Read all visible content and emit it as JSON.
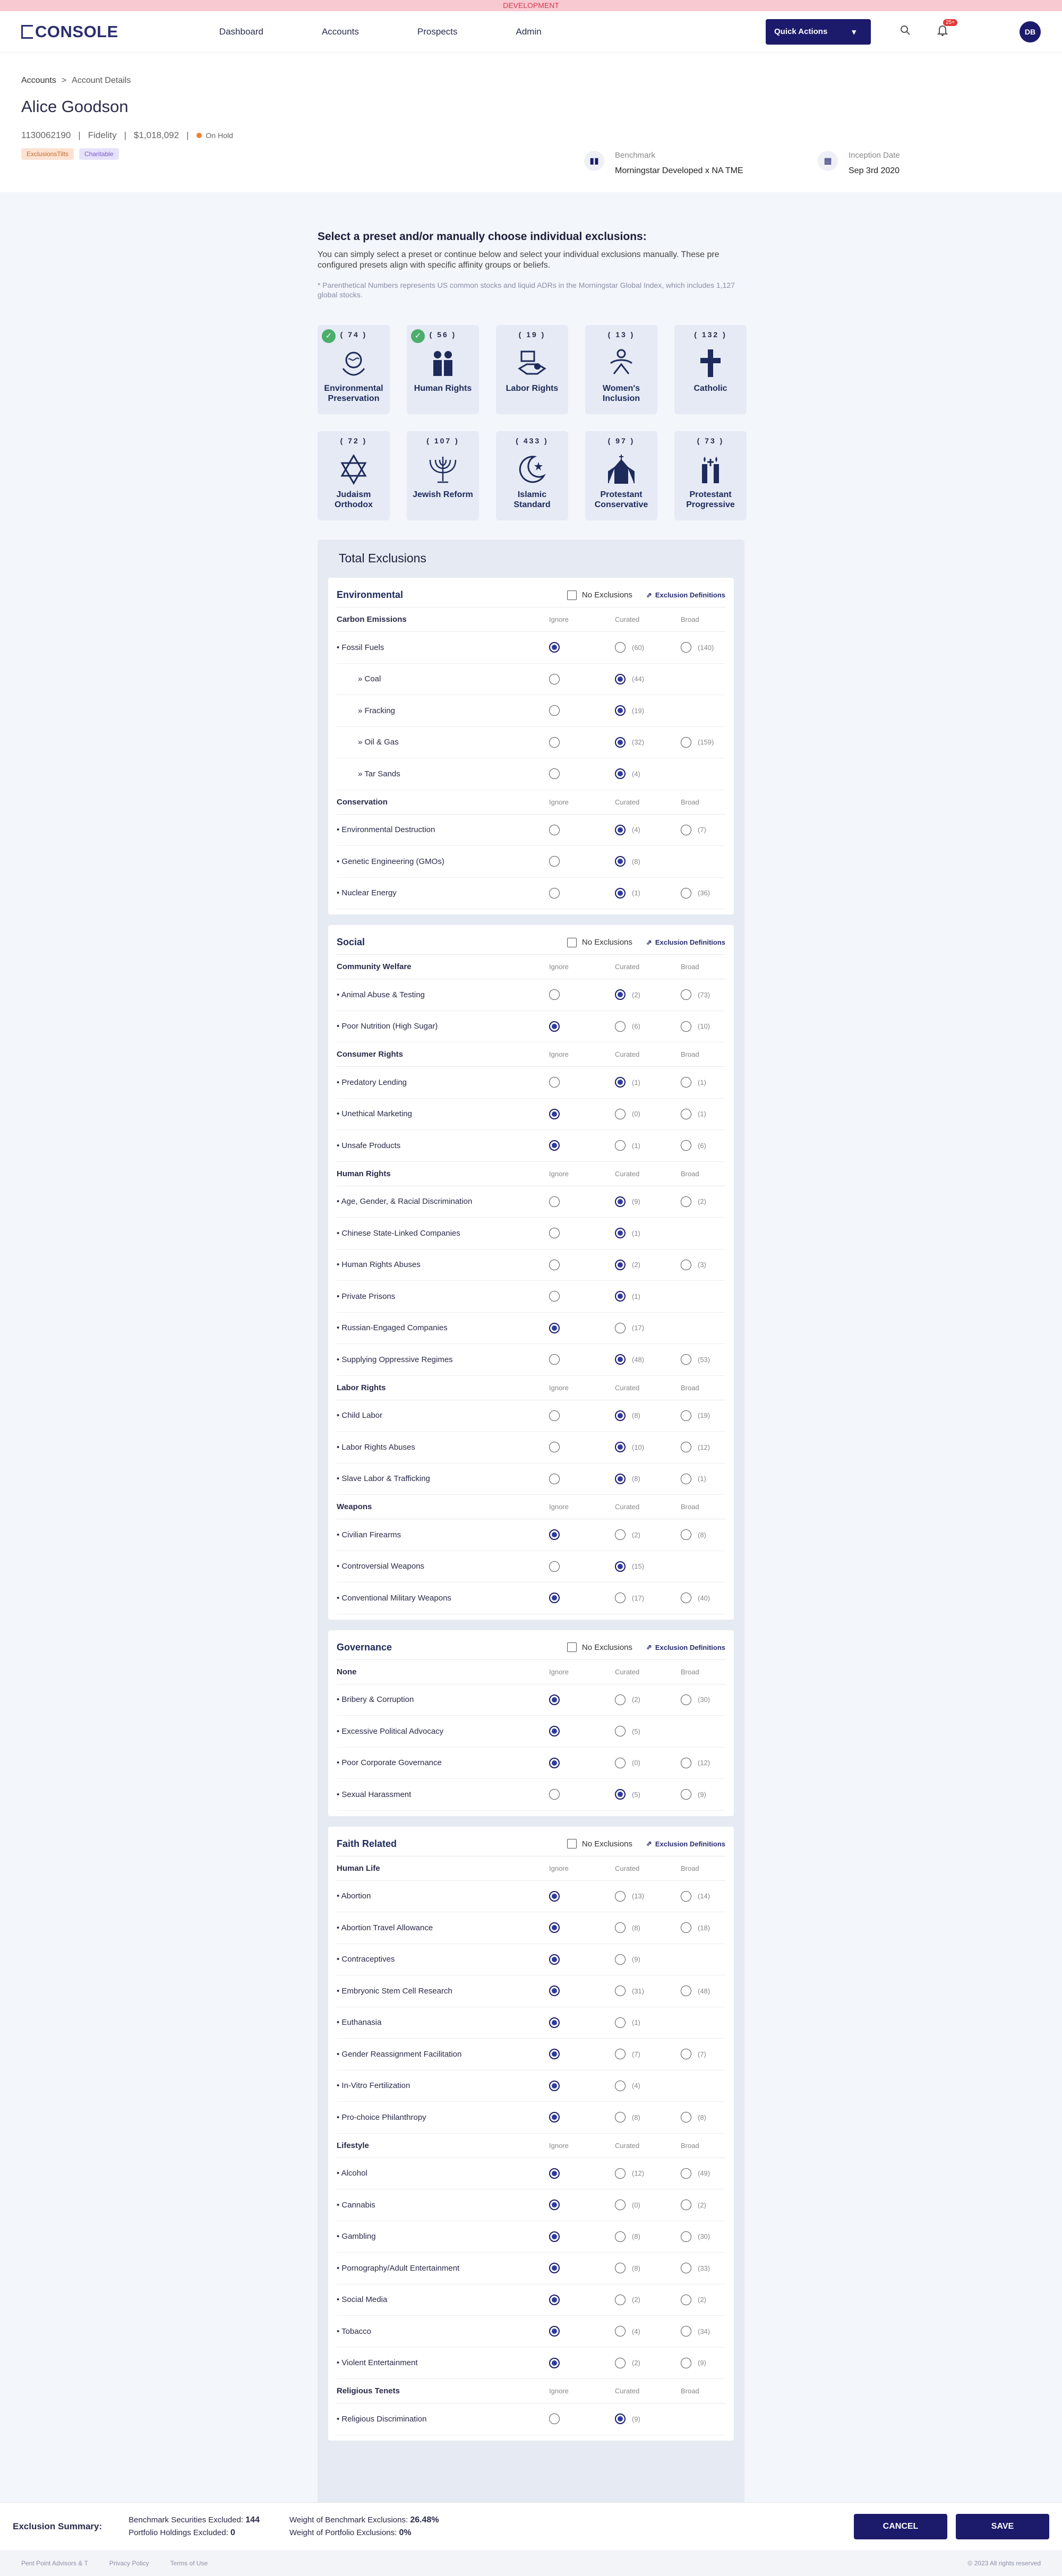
{
  "dev_banner": "DEVELOPMENT",
  "brand": "CONSOLE",
  "nav": [
    "Dashboard",
    "Accounts",
    "Prospects",
    "Admin"
  ],
  "quick_actions": "Quick Actions",
  "notif_count": "25+",
  "user_initials": "DB",
  "breadcrumb": {
    "root": "Accounts",
    "sep": ">",
    "current": "Account Details"
  },
  "client": {
    "name": "Alice Goodson",
    "account": "1130062190",
    "custodian": "Fidelity",
    "value": "$1,018,092",
    "status": "On Hold",
    "tags": [
      "ExclusionsTilts",
      "Charitable"
    ]
  },
  "benchmark": {
    "label": "Benchmark",
    "value": "Morningstar Developed x NA TME"
  },
  "inception": {
    "label": "Inception Date",
    "value": "Sep 3rd 2020"
  },
  "intro": {
    "title": "Select a preset and/or manually choose individual exclusions:",
    "text": "You can simply select a preset or continue below and select your individual exclusions manually. These pre configured presets align with specific affinity groups or beliefs.",
    "footnote": "* Parenthetical Numbers represents US common stocks and liquid ADRs in the Morningstar Global Index, which includes 1,127 global stocks."
  },
  "presets": [
    {
      "name": "Environmental Preservation",
      "count": "( 74 )",
      "checked": true,
      "icon": "globe-hands-icon"
    },
    {
      "name": "Human Rights",
      "count": "( 56 )",
      "checked": true,
      "icon": "people-icon"
    },
    {
      "name": "Labor Rights",
      "count": "( 19 )",
      "checked": false,
      "icon": "handshake-icon"
    },
    {
      "name": "Women's Inclusion",
      "count": "( 13 )",
      "checked": false,
      "icon": "women-icon"
    },
    {
      "name": "Catholic",
      "count": "( 132 )",
      "checked": false,
      "icon": "cross-icon"
    },
    {
      "name": "Judaism Orthodox",
      "count": "( 72 )",
      "checked": false,
      "icon": "star-of-david-icon"
    },
    {
      "name": "Jewish Reform",
      "count": "( 107 )",
      "checked": false,
      "icon": "menorah-icon"
    },
    {
      "name": "Islamic Standard",
      "count": "( 433 )",
      "checked": false,
      "icon": "crescent-icon"
    },
    {
      "name": "Protestant Conservative",
      "count": "( 97 )",
      "checked": false,
      "icon": "church-icon"
    },
    {
      "name": "Protestant Progressive",
      "count": "( 73 )",
      "checked": false,
      "icon": "candles-icon"
    }
  ],
  "total_title": "Total Exclusions",
  "no_exclusions_label": "No Exclusions",
  "exclusion_definitions_label": "Exclusion Definitions",
  "col_labels": {
    "ignore": "Ignore",
    "curated": "Curated",
    "broad": "Broad"
  },
  "categories": [
    {
      "title": "Environmental",
      "groups": [
        {
          "name": "Carbon Emissions",
          "rows": [
            {
              "n": "• Fossil Fuels",
              "sel": 0,
              "c": "(60)",
              "b": "(140)"
            },
            {
              "n": "» Coal",
              "sub": true,
              "sel": 1,
              "c": "(44)",
              "b": null
            },
            {
              "n": "» Fracking",
              "sub": true,
              "sel": 1,
              "c": "(19)",
              "b": null
            },
            {
              "n": "» Oil & Gas",
              "sub": true,
              "sel": 1,
              "c": "(32)",
              "b": "(159)"
            },
            {
              "n": "» Tar Sands",
              "sub": true,
              "sel": 1,
              "c": "(4)",
              "b": null
            }
          ]
        },
        {
          "name": "Conservation",
          "rows": [
            {
              "n": "• Environmental Destruction",
              "sel": 1,
              "c": "(4)",
              "b": "(7)"
            },
            {
              "n": "• Genetic Engineering (GMOs)",
              "sel": 1,
              "c": "(8)",
              "b": null
            },
            {
              "n": "• Nuclear Energy",
              "sel": 1,
              "c": "(1)",
              "b": "(36)"
            }
          ]
        }
      ]
    },
    {
      "title": "Social",
      "groups": [
        {
          "name": "Community Welfare",
          "rows": [
            {
              "n": "• Animal Abuse & Testing",
              "sel": 1,
              "c": "(2)",
              "b": "(73)"
            },
            {
              "n": "• Poor Nutrition (High Sugar)",
              "sel": 0,
              "c": "(6)",
              "b": "(10)"
            }
          ]
        },
        {
          "name": "Consumer Rights",
          "rows": [
            {
              "n": "• Predatory Lending",
              "sel": 1,
              "c": "(1)",
              "b": "(1)"
            },
            {
              "n": "• Unethical Marketing",
              "sel": 0,
              "c": "(0)",
              "b": "(1)"
            },
            {
              "n": "• Unsafe Products",
              "sel": 0,
              "c": "(1)",
              "b": "(6)"
            }
          ]
        },
        {
          "name": "Human Rights",
          "rows": [
            {
              "n": "• Age, Gender, & Racial Discrimination",
              "sel": 1,
              "c": "(9)",
              "b": "(2)"
            },
            {
              "n": "• Chinese State-Linked Companies",
              "sel": 1,
              "c": "(1)",
              "b": null
            },
            {
              "n": "• Human Rights Abuses",
              "sel": 1,
              "c": "(2)",
              "b": "(3)"
            },
            {
              "n": "• Private Prisons",
              "sel": 1,
              "c": "(1)",
              "b": null
            },
            {
              "n": "• Russian-Engaged Companies",
              "sel": 0,
              "c": "(17)",
              "b": null
            },
            {
              "n": "• Supplying Oppressive Regimes",
              "sel": 1,
              "c": "(48)",
              "b": "(53)"
            }
          ]
        },
        {
          "name": "Labor Rights",
          "rows": [
            {
              "n": "• Child Labor",
              "sel": 1,
              "c": "(8)",
              "b": "(19)"
            },
            {
              "n": "• Labor Rights Abuses",
              "sel": 1,
              "c": "(10)",
              "b": "(12)"
            },
            {
              "n": "• Slave Labor & Trafficking",
              "sel": 1,
              "c": "(8)",
              "b": "(1)"
            }
          ]
        },
        {
          "name": "Weapons",
          "rows": [
            {
              "n": "• Civilian Firearms",
              "sel": 0,
              "c": "(2)",
              "b": "(8)"
            },
            {
              "n": "• Controversial Weapons",
              "sel": 1,
              "c": "(15)",
              "b": null
            },
            {
              "n": "• Conventional Military Weapons",
              "sel": 0,
              "c": "(17)",
              "b": "(40)"
            }
          ]
        }
      ]
    },
    {
      "title": "Governance",
      "groups": [
        {
          "name": "None",
          "rows": [
            {
              "n": "• Bribery & Corruption",
              "sel": 0,
              "c": "(2)",
              "b": "(30)"
            },
            {
              "n": "• Excessive Political Advocacy",
              "sel": 0,
              "c": "(5)",
              "b": null
            },
            {
              "n": "• Poor Corporate Governance",
              "sel": 0,
              "c": "(0)",
              "b": "(12)"
            },
            {
              "n": "• Sexual Harassment",
              "sel": 1,
              "c": "(5)",
              "b": "(9)"
            }
          ]
        }
      ]
    },
    {
      "title": "Faith Related",
      "groups": [
        {
          "name": "Human Life",
          "rows": [
            {
              "n": "• Abortion",
              "sel": 0,
              "c": "(13)",
              "b": "(14)"
            },
            {
              "n": "• Abortion Travel Allowance",
              "sel": 0,
              "c": "(8)",
              "b": "(18)"
            },
            {
              "n": "• Contraceptives",
              "sel": 0,
              "c": "(9)",
              "b": null
            },
            {
              "n": "• Embryonic Stem Cell Research",
              "sel": 0,
              "c": "(31)",
              "b": "(48)"
            },
            {
              "n": "• Euthanasia",
              "sel": 0,
              "c": "(1)",
              "b": null
            },
            {
              "n": "• Gender Reassignment Facilitation",
              "sel": 0,
              "c": "(7)",
              "b": "(7)"
            },
            {
              "n": "• In-Vitro Fertilization",
              "sel": 0,
              "c": "(4)",
              "b": null
            },
            {
              "n": "• Pro-choice Philanthropy",
              "sel": 0,
              "c": "(8)",
              "b": "(8)"
            }
          ]
        },
        {
          "name": "Lifestyle",
          "rows": [
            {
              "n": "• Alcohol",
              "sel": 0,
              "c": "(12)",
              "b": "(49)"
            },
            {
              "n": "• Cannabis",
              "sel": 0,
              "c": "(0)",
              "b": "(2)"
            },
            {
              "n": "• Gambling",
              "sel": 0,
              "c": "(8)",
              "b": "(30)"
            },
            {
              "n": "• Pornography/Adult Entertainment",
              "sel": 0,
              "c": "(8)",
              "b": "(33)"
            },
            {
              "n": "• Social Media",
              "sel": 0,
              "c": "(2)",
              "b": "(2)"
            },
            {
              "n": "• Tobacco",
              "sel": 0,
              "c": "(4)",
              "b": "(34)"
            },
            {
              "n": "• Violent Entertainment",
              "sel": 0,
              "c": "(2)",
              "b": "(9)"
            }
          ]
        },
        {
          "name": "Religious Tenets",
          "rows": [
            {
              "n": "• Religious Discrimination",
              "sel": 1,
              "c": "(9)",
              "b": null
            }
          ]
        }
      ]
    }
  ],
  "summary": {
    "label": "Exclusion Summary:",
    "bench_excl_label": "Benchmark Securities Excluded:",
    "bench_excl": "144",
    "port_excl_label": "Portfolio Holdings Excluded:",
    "port_excl": "0",
    "wbench_label": "Weight of Benchmark Exclusions:",
    "wbench": "26.48%",
    "wport_label": "Weight of Portfolio Exclusions:",
    "wport": "0%",
    "cancel": "CANCEL",
    "save": "SAVE"
  },
  "footer": {
    "links": [
      "Pent Point Advisors & T",
      "Privacy Policy",
      "Terms of Use"
    ],
    "copyright": "© 2023 All rights reserved"
  },
  "colors": {
    "primary": "#1c1a6b",
    "check": "#4cae6b",
    "hold": "#f08030"
  }
}
